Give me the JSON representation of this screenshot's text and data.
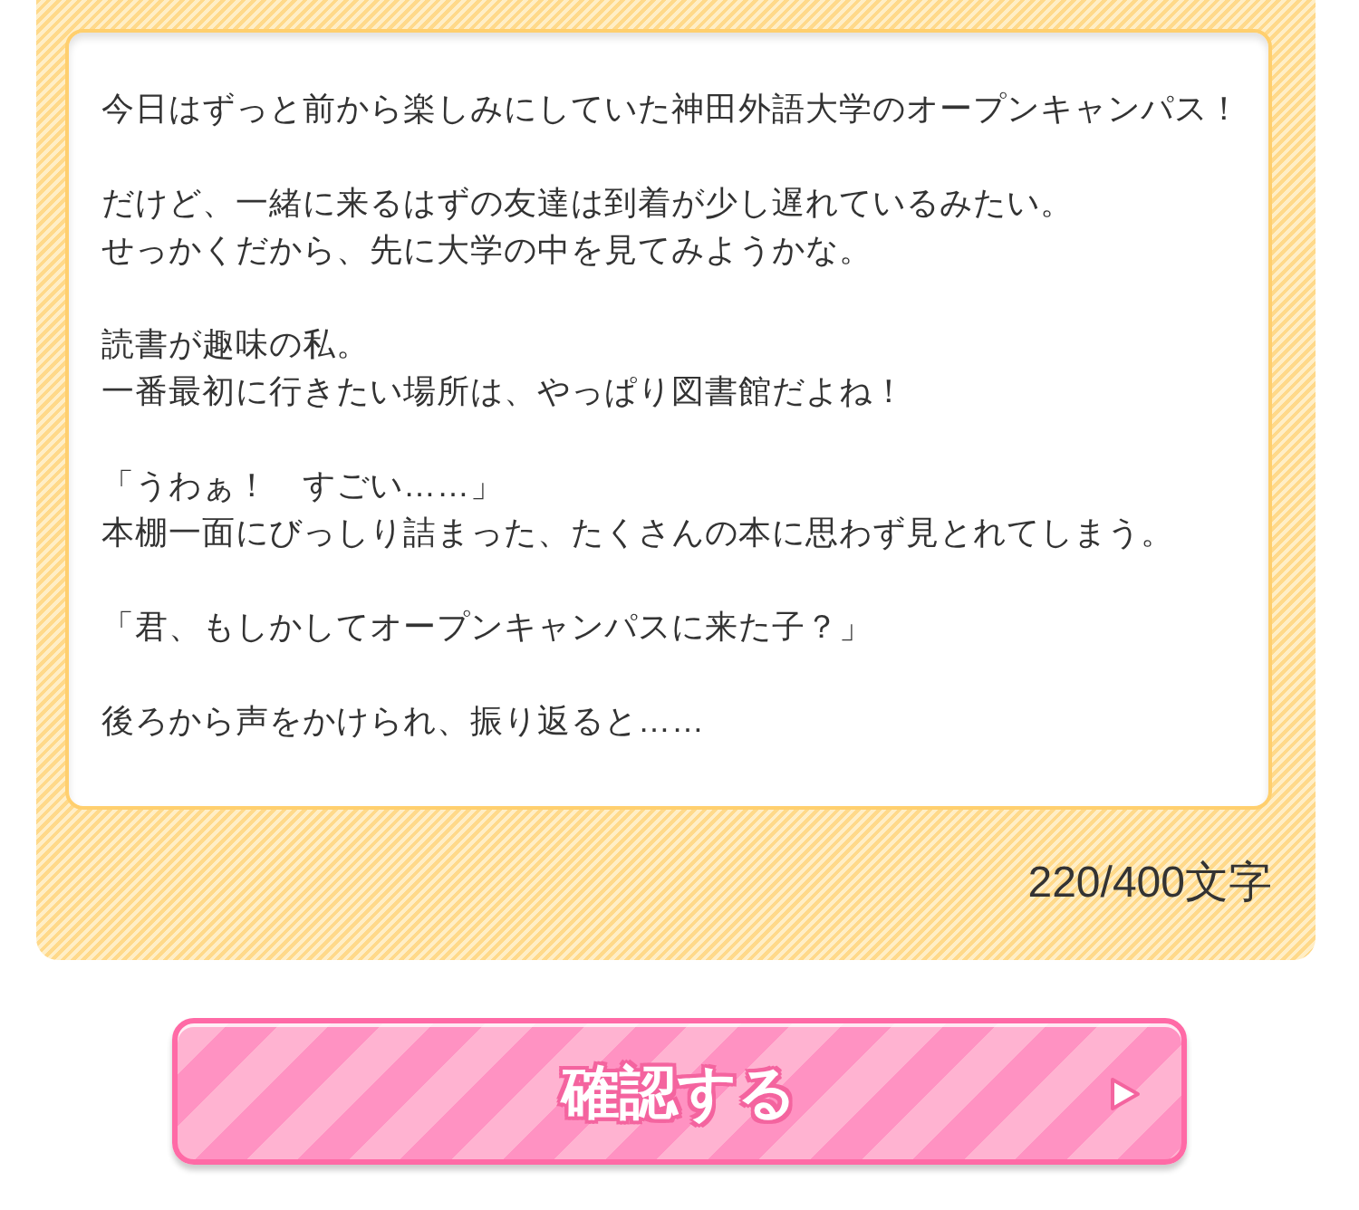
{
  "story_field": {
    "paragraphs": [
      [
        "今日はずっと前から楽しみにしていた神田外語大学のオープンキャンパス！"
      ],
      [
        "だけど、一緒に来るはずの友達は到着が少し遅れているみたい。",
        "せっかくだから、先に大学の中を見てみようかな。"
      ],
      [
        "読書が趣味の私。",
        "一番最初に行きたい場所は、やっぱり図書館だよね！"
      ],
      [
        "「うわぁ！　すごい……」",
        "本棚一面にびっしり詰まった、たくさんの本に思わず見とれてしまう。"
      ],
      [
        "「君、もしかしてオープンキャンパスに来た子？」"
      ],
      [
        "後ろから声をかけられ、振り返ると……"
      ]
    ]
  },
  "char_count": "220/400文字",
  "confirm_button": {
    "label": "確認する"
  }
}
